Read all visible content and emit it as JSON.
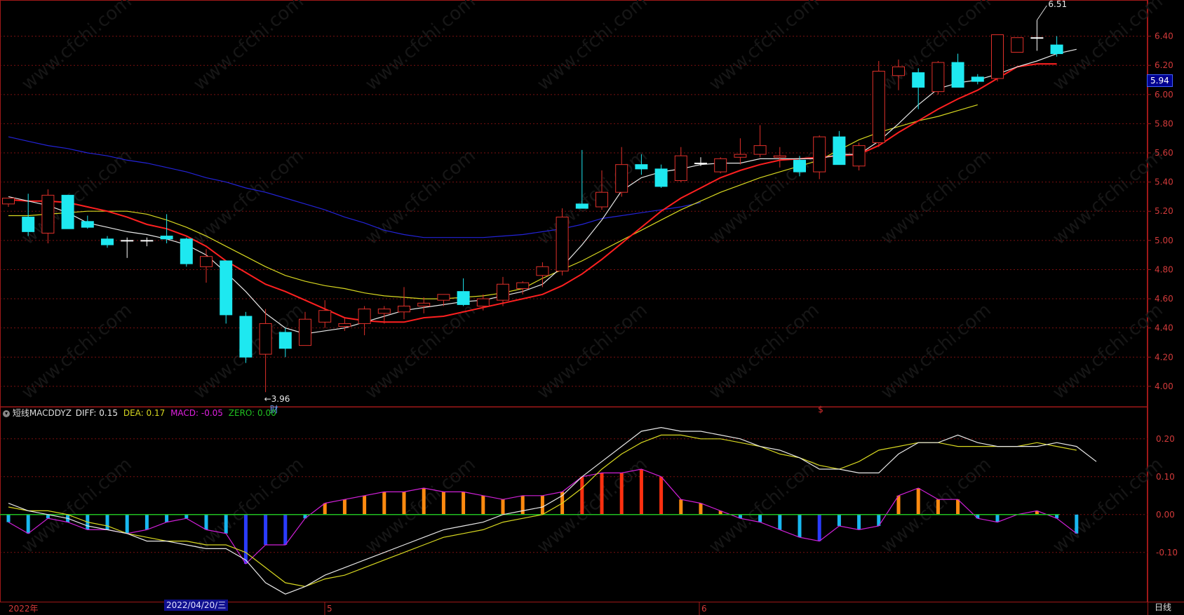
{
  "colors": {
    "bg": "#000000",
    "grid": "#7a1010",
    "frame": "#a01818",
    "axis_text": "#d23a3a",
    "up": "#e0302a",
    "down": "#1ee8f0",
    "ma_white": "#e8e8e8",
    "ma_red": "#ff2020",
    "ma_yellow": "#d8d820",
    "ma_blue": "#2323d8",
    "diff": "#e8e8e8",
    "dea": "#d8d820",
    "zero": "#20c020",
    "price_tag_bg": "#000090",
    "date_tag_bg": "#101090"
  },
  "watermark": "www.cfchi.com",
  "price_axis": {
    "min": 3.86,
    "max": 6.6,
    "ticks": [
      "6.40",
      "6.20",
      "6.00",
      "5.80",
      "5.60",
      "5.40",
      "5.20",
      "5.00",
      "4.80",
      "4.60",
      "4.40",
      "4.20",
      "4.00"
    ]
  },
  "current_price_label": "5.94",
  "high_label": "6.51",
  "low_label": "←3.96",
  "cai_marker": "财",
  "dollar_marker": "$",
  "macd": {
    "header_prefix": "短线MACDDYZ",
    "diff_text": "DIFF: 0.15",
    "dea_text": "DEA: 0.17",
    "macd_text": "MACD: -0.05",
    "zero_text": "ZERO: 0.00",
    "axis": {
      "min": -0.23,
      "max": 0.27,
      "ticks": [
        "0.20",
        "0.10",
        "0.00",
        "-0.10"
      ]
    }
  },
  "date_axis": {
    "year_label": "2022年",
    "cursor_date": "2022/04/20/三",
    "month_5": "5",
    "month_6": "6"
  },
  "period_label": "日线",
  "chart_data": {
    "type": "candlestick",
    "candles": [
      {
        "o": 5.25,
        "h": 5.28,
        "l": 5.23,
        "c": 5.29
      },
      {
        "o": 5.16,
        "h": 5.32,
        "l": 5.03,
        "c": 5.06
      },
      {
        "o": 5.05,
        "h": 5.35,
        "l": 4.98,
        "c": 5.31
      },
      {
        "o": 5.31,
        "h": 5.31,
        "l": 5.08,
        "c": 5.08
      },
      {
        "o": 5.13,
        "h": 5.17,
        "l": 5.08,
        "c": 5.09
      },
      {
        "o": 5.01,
        "h": 5.03,
        "l": 4.95,
        "c": 4.97
      },
      {
        "o": 5.0,
        "h": 5.02,
        "l": 4.88,
        "c": 5.0
      },
      {
        "o": 5.0,
        "h": 5.02,
        "l": 4.96,
        "c": 5.0
      },
      {
        "o": 5.03,
        "h": 5.18,
        "l": 4.98,
        "c": 5.01
      },
      {
        "o": 5.01,
        "h": 5.02,
        "l": 4.82,
        "c": 4.84
      },
      {
        "o": 4.82,
        "h": 4.94,
        "l": 4.71,
        "c": 4.89
      },
      {
        "o": 4.86,
        "h": 4.86,
        "l": 4.43,
        "c": 4.49
      },
      {
        "o": 4.48,
        "h": 4.51,
        "l": 4.16,
        "c": 4.2
      },
      {
        "o": 4.22,
        "h": 4.53,
        "l": 3.96,
        "c": 4.43
      },
      {
        "o": 4.37,
        "h": 4.4,
        "l": 4.2,
        "c": 4.26
      },
      {
        "o": 4.28,
        "h": 4.51,
        "l": 4.28,
        "c": 4.46
      },
      {
        "o": 4.44,
        "h": 4.59,
        "l": 4.4,
        "c": 4.52
      },
      {
        "o": 4.41,
        "h": 4.47,
        "l": 4.38,
        "c": 4.43
      },
      {
        "o": 4.43,
        "h": 4.55,
        "l": 4.35,
        "c": 4.53
      },
      {
        "o": 4.5,
        "h": 4.55,
        "l": 4.43,
        "c": 4.53
      },
      {
        "o": 4.51,
        "h": 4.68,
        "l": 4.46,
        "c": 4.55
      },
      {
        "o": 4.55,
        "h": 4.61,
        "l": 4.5,
        "c": 4.57
      },
      {
        "o": 4.59,
        "h": 4.62,
        "l": 4.55,
        "c": 4.63
      },
      {
        "o": 4.65,
        "h": 4.74,
        "l": 4.55,
        "c": 4.56
      },
      {
        "o": 4.55,
        "h": 4.63,
        "l": 4.52,
        "c": 4.6
      },
      {
        "o": 4.59,
        "h": 4.75,
        "l": 4.55,
        "c": 4.7
      },
      {
        "o": 4.67,
        "h": 4.72,
        "l": 4.63,
        "c": 4.71
      },
      {
        "o": 4.76,
        "h": 4.85,
        "l": 4.68,
        "c": 4.82
      },
      {
        "o": 4.79,
        "h": 5.22,
        "l": 4.76,
        "c": 5.16
      },
      {
        "o": 5.25,
        "h": 5.62,
        "l": 5.22,
        "c": 5.22
      },
      {
        "o": 5.23,
        "h": 5.48,
        "l": 5.21,
        "c": 5.33
      },
      {
        "o": 5.33,
        "h": 5.64,
        "l": 5.3,
        "c": 5.52
      },
      {
        "o": 5.52,
        "h": 5.59,
        "l": 5.45,
        "c": 5.49
      },
      {
        "o": 5.49,
        "h": 5.52,
        "l": 5.36,
        "c": 5.37
      },
      {
        "o": 5.41,
        "h": 5.64,
        "l": 5.4,
        "c": 5.58
      },
      {
        "o": 5.53,
        "h": 5.57,
        "l": 5.51,
        "c": 5.53
      },
      {
        "o": 5.47,
        "h": 5.57,
        "l": 5.46,
        "c": 5.56
      },
      {
        "o": 5.57,
        "h": 5.7,
        "l": 5.52,
        "c": 5.59
      },
      {
        "o": 5.59,
        "h": 5.79,
        "l": 5.57,
        "c": 5.65
      },
      {
        "o": 5.57,
        "h": 5.64,
        "l": 5.5,
        "c": 5.58
      },
      {
        "o": 5.55,
        "h": 5.58,
        "l": 5.44,
        "c": 5.47
      },
      {
        "o": 5.47,
        "h": 5.72,
        "l": 5.42,
        "c": 5.71
      },
      {
        "o": 5.71,
        "h": 5.75,
        "l": 5.52,
        "c": 5.52
      },
      {
        "o": 5.51,
        "h": 5.67,
        "l": 5.48,
        "c": 5.65
      },
      {
        "o": 5.67,
        "h": 6.23,
        "l": 5.64,
        "c": 6.16
      },
      {
        "o": 6.13,
        "h": 6.24,
        "l": 6.03,
        "c": 6.19
      },
      {
        "o": 6.15,
        "h": 6.18,
        "l": 5.9,
        "c": 6.05
      },
      {
        "o": 6.02,
        "h": 6.23,
        "l": 6.0,
        "c": 6.22
      },
      {
        "o": 6.22,
        "h": 6.28,
        "l": 6.06,
        "c": 6.05
      },
      {
        "o": 6.12,
        "h": 6.14,
        "l": 6.07,
        "c": 6.09
      },
      {
        "o": 6.11,
        "h": 6.41,
        "l": 6.09,
        "c": 6.41
      },
      {
        "o": 6.29,
        "h": 6.36,
        "l": 6.29,
        "c": 6.39
      },
      {
        "o": 6.39,
        "h": 6.51,
        "l": 6.3,
        "c": 6.39
      },
      {
        "o": 6.34,
        "h": 6.4,
        "l": 6.26,
        "c": 6.28
      }
    ],
    "ma_white": [
      5.3,
      5.27,
      5.24,
      5.19,
      5.12,
      5.09,
      5.06,
      5.04,
      5.01,
      4.97,
      4.9,
      4.78,
      4.65,
      4.5,
      4.4,
      4.36,
      4.38,
      4.4,
      4.44,
      4.48,
      4.52,
      4.54,
      4.56,
      4.58,
      4.59,
      4.62,
      4.65,
      4.7,
      4.82,
      4.97,
      5.14,
      5.34,
      5.43,
      5.47,
      5.49,
      5.52,
      5.53,
      5.53,
      5.56,
      5.56,
      5.56,
      5.56,
      5.59,
      5.59,
      5.68,
      5.8,
      5.93,
      6.04,
      6.08,
      6.1,
      6.14,
      6.19,
      6.23,
      6.28,
      6.31
    ],
    "ma_red": [
      5.28,
      5.27,
      5.27,
      5.26,
      5.23,
      5.2,
      5.16,
      5.11,
      5.08,
      5.03,
      4.96,
      4.86,
      4.78,
      4.7,
      4.65,
      4.59,
      4.53,
      4.47,
      4.45,
      4.44,
      4.44,
      4.47,
      4.48,
      4.51,
      4.54,
      4.57,
      4.6,
      4.63,
      4.69,
      4.77,
      4.87,
      4.98,
      5.09,
      5.2,
      5.29,
      5.36,
      5.43,
      5.48,
      5.52,
      5.55,
      5.56,
      5.57,
      5.58,
      5.59,
      5.65,
      5.74,
      5.82,
      5.9,
      5.97,
      6.03,
      6.11,
      6.19,
      6.21,
      6.21
    ],
    "ma_yellow": [
      5.17,
      5.17,
      5.18,
      5.19,
      5.2,
      5.2,
      5.2,
      5.18,
      5.14,
      5.09,
      5.03,
      4.96,
      4.89,
      4.82,
      4.76,
      4.72,
      4.69,
      4.67,
      4.64,
      4.62,
      4.61,
      4.6,
      4.6,
      4.61,
      4.62,
      4.64,
      4.67,
      4.74,
      4.8,
      4.86,
      4.93,
      5.0,
      5.07,
      5.14,
      5.21,
      5.27,
      5.33,
      5.38,
      5.43,
      5.47,
      5.51,
      5.55,
      5.62,
      5.69,
      5.74,
      5.78,
      5.82,
      5.85,
      5.89,
      5.93
    ],
    "ma_blue": [
      5.71,
      5.68,
      5.65,
      5.63,
      5.6,
      5.58,
      5.55,
      5.53,
      5.5,
      5.47,
      5.43,
      5.4,
      5.36,
      5.33,
      5.29,
      5.25,
      5.21,
      5.16,
      5.12,
      5.07,
      5.04,
      5.02,
      5.02,
      5.02,
      5.02,
      5.03,
      5.04,
      5.06,
      5.08,
      5.11,
      5.15,
      5.17,
      5.19,
      5.21,
      5.23,
      5.26
    ],
    "macd_hist": [
      -0.02,
      -0.05,
      -0.01,
      -0.02,
      -0.04,
      -0.04,
      -0.05,
      -0.04,
      -0.02,
      -0.01,
      -0.04,
      -0.05,
      -0.13,
      -0.08,
      -0.08,
      -0.01,
      0.03,
      0.04,
      0.05,
      0.06,
      0.06,
      0.07,
      0.06,
      0.06,
      0.05,
      0.04,
      0.05,
      0.05,
      0.06,
      0.1,
      0.11,
      0.11,
      0.12,
      0.1,
      0.04,
      0.03,
      0.01,
      -0.01,
      -0.02,
      -0.04,
      -0.06,
      -0.07,
      -0.03,
      -0.04,
      -0.03,
      0.05,
      0.07,
      0.04,
      0.04,
      -0.01,
      -0.02,
      0.0,
      0.01,
      -0.01,
      -0.05
    ],
    "diff": [
      0.03,
      0.01,
      0.0,
      -0.01,
      -0.03,
      -0.04,
      -0.05,
      -0.07,
      -0.07,
      -0.08,
      -0.09,
      -0.09,
      -0.12,
      -0.18,
      -0.21,
      -0.19,
      -0.16,
      -0.14,
      -0.12,
      -0.1,
      -0.08,
      -0.06,
      -0.04,
      -0.03,
      -0.02,
      0.0,
      0.01,
      0.02,
      0.05,
      0.1,
      0.14,
      0.18,
      0.22,
      0.23,
      0.22,
      0.22,
      0.21,
      0.2,
      0.18,
      0.17,
      0.15,
      0.12,
      0.12,
      0.11,
      0.11,
      0.16,
      0.19,
      0.19,
      0.21,
      0.19,
      0.18,
      0.18,
      0.18,
      0.19,
      0.18,
      0.14
    ],
    "dea": [
      0.02,
      0.01,
      0.01,
      0.0,
      -0.02,
      -0.03,
      -0.05,
      -0.06,
      -0.07,
      -0.07,
      -0.08,
      -0.08,
      -0.1,
      -0.14,
      -0.18,
      -0.19,
      -0.17,
      -0.16,
      -0.14,
      -0.12,
      -0.1,
      -0.08,
      -0.06,
      -0.05,
      -0.04,
      -0.02,
      -0.01,
      0.0,
      0.03,
      0.07,
      0.12,
      0.16,
      0.19,
      0.21,
      0.21,
      0.2,
      0.2,
      0.19,
      0.18,
      0.16,
      0.15,
      0.13,
      0.12,
      0.14,
      0.17,
      0.18,
      0.19,
      0.19,
      0.18,
      0.18,
      0.18,
      0.18,
      0.19,
      0.18,
      0.17
    ]
  }
}
